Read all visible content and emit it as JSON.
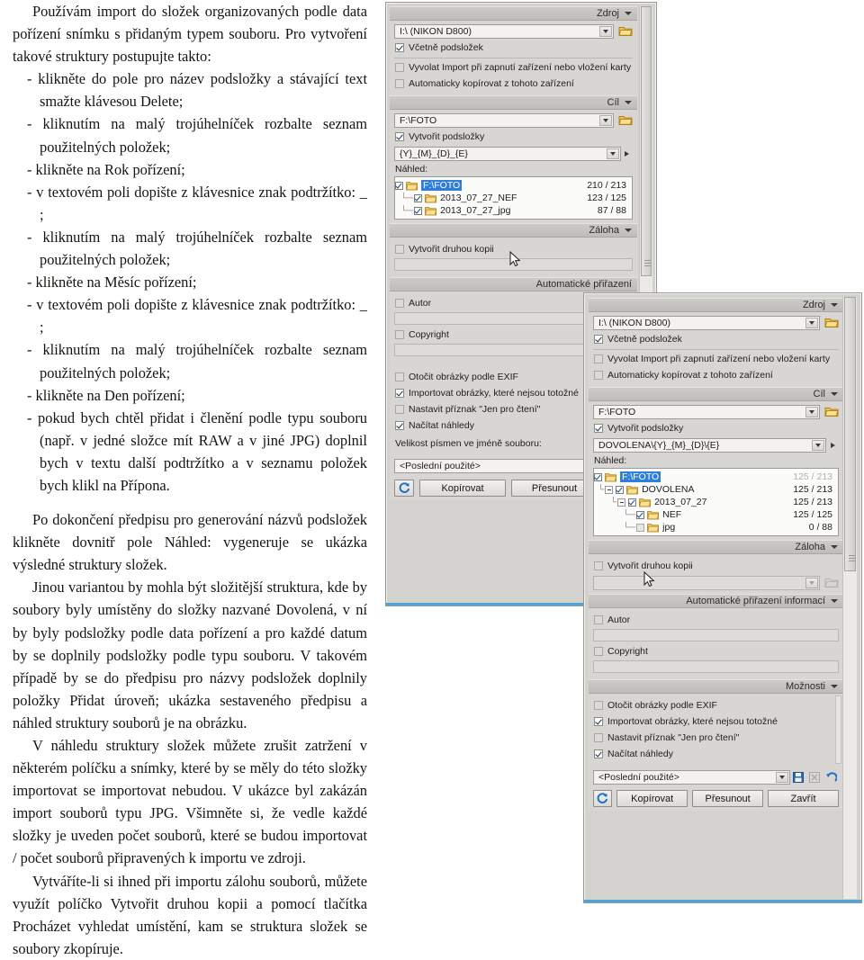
{
  "article": {
    "paragraphs": [
      {
        "type": "p",
        "indent": true,
        "text": "Používám import do složek organizovaných podle data pořízení snímku s přidaným typem souboru. Pro vytvoření takové struktury postupujte takto:"
      },
      {
        "type": "li",
        "text": "- klikněte do pole pro název podsložky a stávající text smažte klávesou Delete;"
      },
      {
        "type": "li",
        "text": "- kliknutím na malý trojúhelníček rozbalte seznam použitelných položek;"
      },
      {
        "type": "li",
        "text": "- klikněte na Rok pořízení;"
      },
      {
        "type": "li",
        "text": "- v textovém poli dopište z klávesnice znak podtržítko: _ ;"
      },
      {
        "type": "li",
        "text": "- kliknutím na malý trojúhelníček rozbalte seznam použitelných položek;"
      },
      {
        "type": "li",
        "text": "- klikněte na Měsíc pořízení;"
      },
      {
        "type": "li",
        "text": "- v textovém poli dopište z klávesnice znak podtržítko: _ ;"
      },
      {
        "type": "li",
        "text": "- kliknutím na malý trojúhelníček rozbalte seznam použitelných položek;"
      },
      {
        "type": "li",
        "text": "- klikněte na Den pořízení;"
      },
      {
        "type": "li",
        "text": "- pokud bych chtěl přidat i členění podle typu souboru (např. v jedné složce mít RAW a v jiné JPG) doplnil bych v textu další podtržítko a v seznamu položek bych klikl na Přípona."
      },
      {
        "type": "p",
        "indent": true,
        "text": "Po dokončení předpisu pro generování názvů podsložek klikněte dovnitř pole Náhled: vygeneruje se ukázka výsledné struktury složek."
      },
      {
        "type": "p",
        "indent": true,
        "text": "Jinou variantou by mohla být složitější struktura, kde by soubory byly umístěny do složky nazvané Dovolená, v ní by byly podsložky podle data pořízení a pro každé datum by se doplnily podsložky podle typu souboru. V takovém případě by se do předpisu pro názvy podsložek doplnily položky Přidat úroveň; ukázka sestaveného předpisu a náhled struktury souborů je na obrázku."
      },
      {
        "type": "p",
        "indent": true,
        "text": "V náhledu struktury složek můžete zrušit zatržení v některém políčku a snímky, které by se měly do této složky importovat se importovat nebudou. V ukázce byl zakázán import souborů typu JPG. Všimněte si, že vedle každé složky je uveden počet souborů, které se budou importovat / počet souborů připravených k importu ve zdroji."
      },
      {
        "type": "p",
        "indent": true,
        "text": "Vytváříte-li si ihned při importu zálohu souborů, můžete využít políčko Vytvořit druhou kopii a pomocí tlačítka Procházet vyhledat umístění, kam se struktura složek se soubory zkopíruje."
      }
    ]
  },
  "dialog_back": {
    "source": {
      "header": "Zdroj",
      "device_value": "I:\\ (NIKON D800)",
      "include_subfolders": "Včetně podsložek",
      "invoke_on_connect": "Vyvolat Import při zapnutí zařízení nebo vložení karty",
      "auto_copy": "Automaticky kopírovat z tohoto zařízení"
    },
    "target": {
      "header": "Cíl",
      "path_value": "F:\\FOTO",
      "create_subfolders": "Vytvořit podsložky",
      "pattern_value": "{Y}_{M}_{D}_{E}",
      "preview_label": "Náhled:",
      "tree": [
        {
          "depth": 0,
          "name": "F:\\FOTO",
          "count": "210 / 213",
          "checked": true,
          "selected": true,
          "expander": false
        },
        {
          "depth": 1,
          "name": "2013_07_27_NEF",
          "count": "123 / 125",
          "checked": true,
          "selected": false,
          "expander": false
        },
        {
          "depth": 1,
          "name": "2013_07_27_jpg",
          "count": "87 / 88",
          "checked": true,
          "selected": false,
          "expander": false
        }
      ]
    },
    "backup": {
      "header": "Záloha",
      "create_second_copy": "Vytvořit druhou kopii"
    },
    "autoassign": {
      "header": "Automatické přiřazení",
      "author": "Autor",
      "copyright": "Copyright"
    },
    "options": {
      "rotate_exif": "Otočit obrázky podle EXIF",
      "import_not_identical": "Importovat obrázky, které nejsou totožné",
      "set_readonly": "Nastavit příznak \"Jen pro čtení\"",
      "load_previews": "Načítat náhledy",
      "case_label": "Velikost písmen ve jméně souboru:"
    },
    "footer": {
      "preset_value": "<Poslední použité>",
      "refresh_icon": "refresh-icon",
      "copy_button": "Kopírovat",
      "move_button": "Přesunout"
    }
  },
  "dialog_front": {
    "source": {
      "header": "Zdroj",
      "device_value": "I:\\ (NIKON D800)",
      "include_subfolders": "Včetně podsložek",
      "invoke_on_connect": "Vyvolat Import při zapnutí zařízení nebo vložení karty",
      "auto_copy": "Automaticky kopírovat z tohoto zařízení"
    },
    "target": {
      "header": "Cíl",
      "path_value": "F:\\FOTO",
      "create_subfolders": "Vytvořit podsložky",
      "pattern_value": "DOVOLENA\\{Y}_{M}_{D}\\{E}",
      "preview_label": "Náhled:",
      "tree": [
        {
          "depth": 0,
          "name": "F:\\FOTO",
          "count": "125 / 213",
          "checked": true,
          "selected": true,
          "expander": false,
          "dim": true
        },
        {
          "depth": 1,
          "name": "DOVOLENA",
          "count": "125 / 213",
          "checked": true,
          "selected": false,
          "expander": true
        },
        {
          "depth": 2,
          "name": "2013_07_27",
          "count": "125 / 213",
          "checked": true,
          "selected": false,
          "expander": true
        },
        {
          "depth": 3,
          "name": "NEF",
          "count": "125 / 125",
          "checked": true,
          "selected": false,
          "expander": false
        },
        {
          "depth": 3,
          "name": "jpg",
          "count": "0 / 88",
          "checked": false,
          "selected": false,
          "expander": false
        }
      ]
    },
    "backup": {
      "header": "Záloha",
      "create_second_copy": "Vytvořit druhou kopii"
    },
    "autoassign": {
      "header": "Automatické přiřazení informací",
      "author": "Autor",
      "copyright": "Copyright"
    },
    "options": {
      "header": "Možnosti",
      "rotate_exif": "Otočit obrázky podle EXIF",
      "import_not_identical": "Importovat obrázky, které nejsou totožné",
      "set_readonly": "Nastavit příznak \"Jen pro čtení\"",
      "load_previews": "Načítat náhledy"
    },
    "footer": {
      "preset_value": "<Poslední použité>",
      "save_icon": "save-icon",
      "delete_icon": "delete-preset-icon",
      "undo_icon": "undo-icon",
      "refresh_icon": "refresh-icon",
      "copy_button": "Kopírovat",
      "move_button": "Přesunout",
      "close_button": "Zavřít"
    }
  },
  "colors": {
    "dialog_face": "#d4d2ce",
    "panel": "#d8d6d2",
    "section_header": "#c6c4c0",
    "field": "#f3f2f0",
    "selection_blue": "#2f7fd8",
    "accent_bar": "#4aa6d8",
    "folder_yellow": "#f5c84a"
  }
}
